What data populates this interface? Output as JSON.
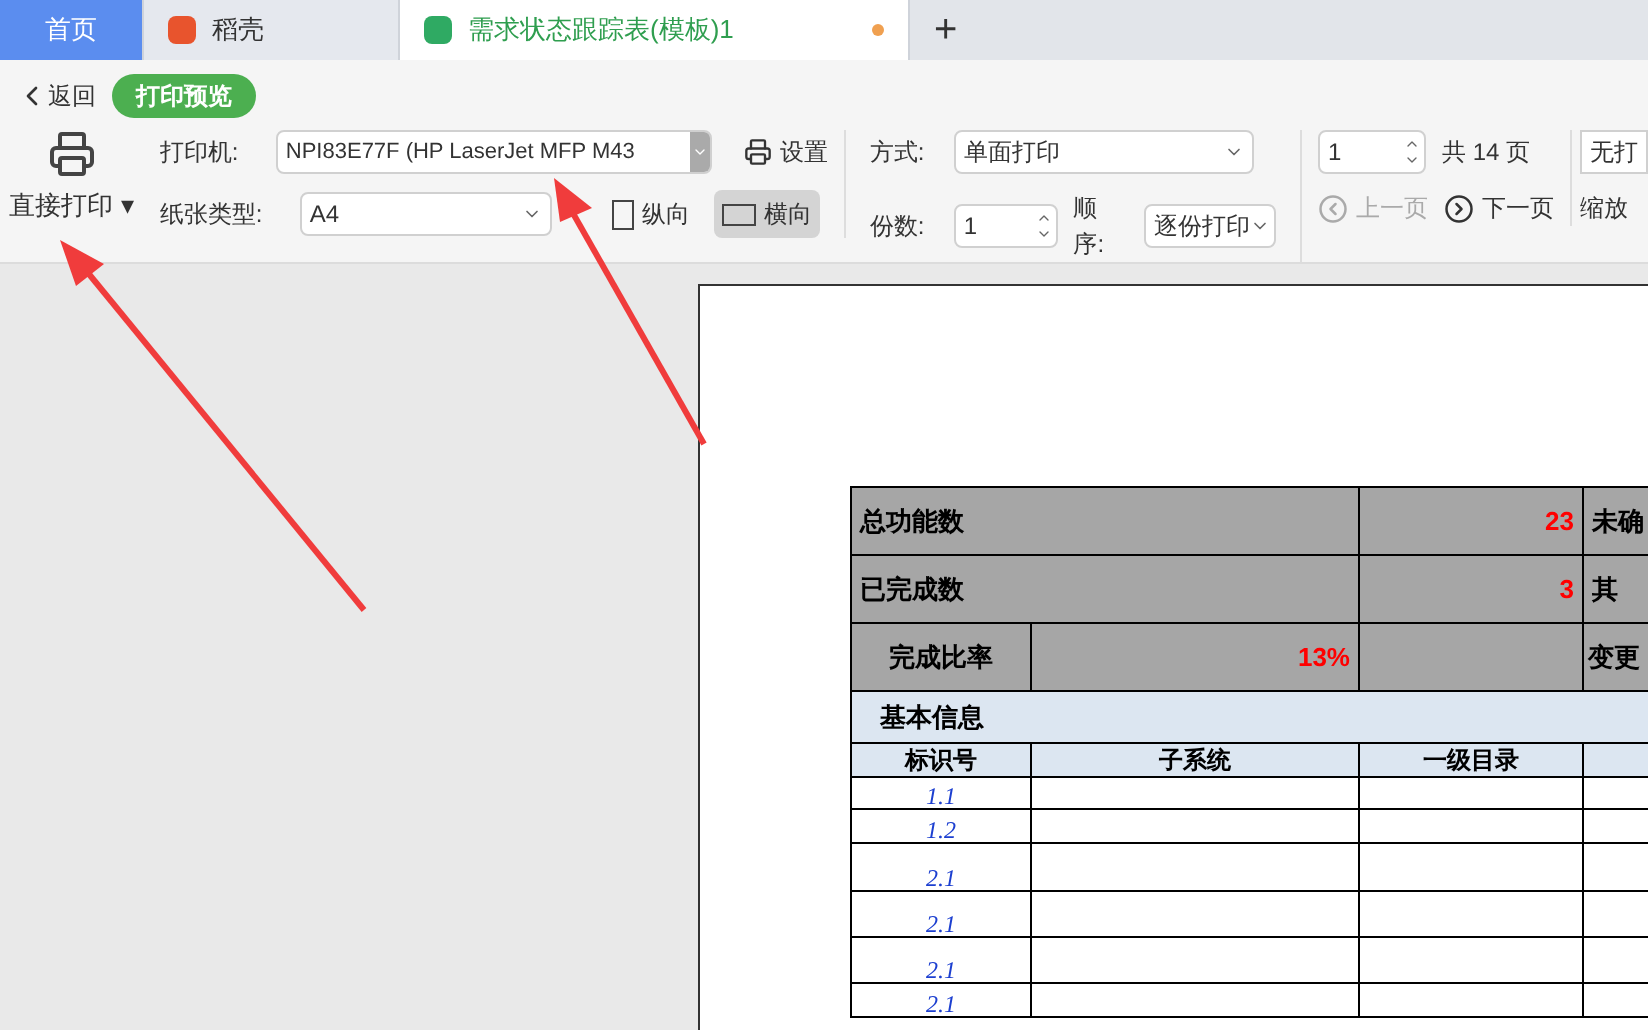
{
  "tabs": [
    {
      "label": "首页",
      "kind": "home",
      "selected": false
    },
    {
      "label": "稻壳",
      "kind": "docer",
      "selected": false
    },
    {
      "label": "需求状态跟踪表(模板)1",
      "kind": "sheet",
      "selected": true,
      "unsaved": true
    }
  ],
  "new_tab": "+",
  "back": "返回",
  "mode": "打印预览",
  "print_button": "直接打印",
  "print_caret": "▾",
  "printer": {
    "label": "打印机:",
    "value": "NPI83E77F (HP LaserJet MFP M43"
  },
  "settings": "设置",
  "paper": {
    "label": "纸张类型:",
    "value": "A4"
  },
  "orientation": [
    {
      "label": "纵向",
      "selected": false
    },
    {
      "label": "横向",
      "selected": true
    }
  ],
  "method": {
    "label": "方式:",
    "value": "单面打印"
  },
  "copies": {
    "label": "份数:",
    "value": "1"
  },
  "order": {
    "label": "顺序:",
    "value": "逐份打印"
  },
  "page": {
    "value": "1",
    "total": "共 14 页"
  },
  "prev_page": {
    "label": "上一页",
    "disabled": true
  },
  "next_page": {
    "label": "下一页",
    "disabled": false
  },
  "cut_right": {
    "top": "无打",
    "bottom": "缩放"
  },
  "sheet": {
    "summary": [
      {
        "label": "总功能数",
        "value": "23",
        "col4": "未确"
      },
      {
        "label": "已完成数",
        "value": "3",
        "col4": "其"
      }
    ],
    "ratio": {
      "label": "完成比率",
      "value": "13%",
      "col4": "变更"
    },
    "section": "基本信息",
    "columns": [
      "标识号",
      "子系统",
      "一级目录"
    ],
    "rows": [
      "1.1",
      "1.2",
      "2.1",
      "2.1",
      "2.1",
      "2.1"
    ]
  }
}
